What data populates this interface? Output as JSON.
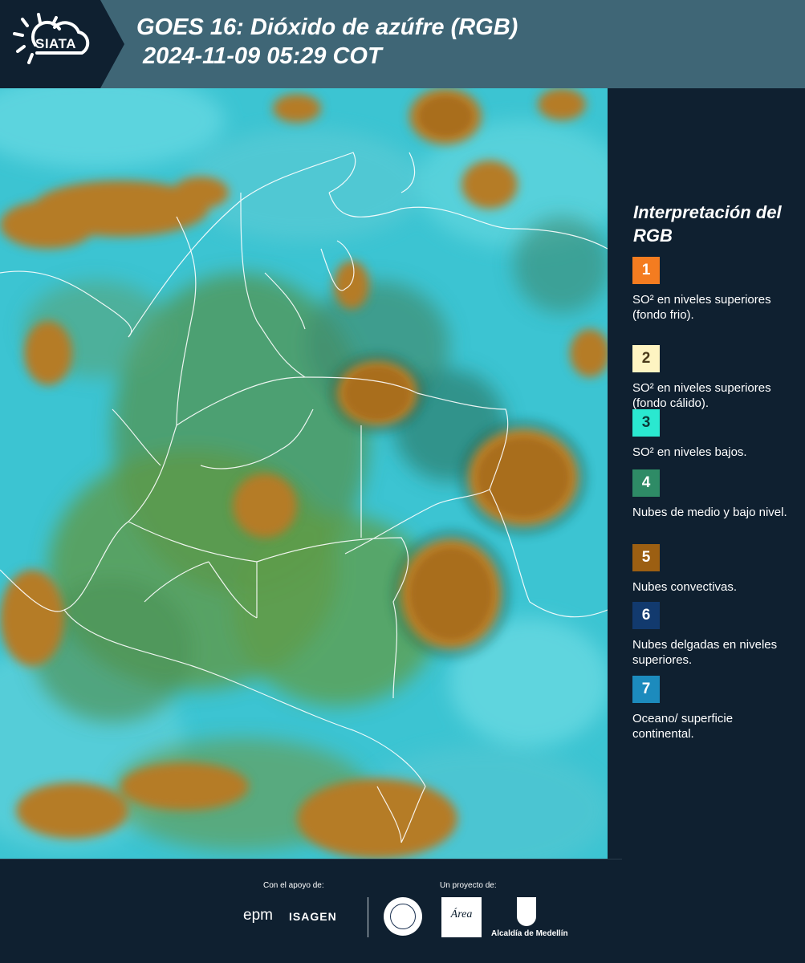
{
  "header": {
    "logo_text": "SIATA",
    "title_line1": "GOES 16: Dióxido de azúfre (RGB)",
    "title_line2": "2024-11-09 05:29 COT"
  },
  "legend": {
    "title": "Interpretación del RGB",
    "items": [
      {
        "number": "1",
        "color": "#f47c20",
        "text_color": "#ffffff",
        "label": "SO² en niveles superiores (fondo frio)."
      },
      {
        "number": "2",
        "color": "#fef4c2",
        "text_color": "#4a3a1a",
        "label": "SO² en niveles superiores (fondo cálido)."
      },
      {
        "number": "3",
        "color": "#2ae8d0",
        "text_color": "#0b3a38",
        "label": "SO² en niveles bajos."
      },
      {
        "number": "4",
        "color": "#2e8b66",
        "text_color": "#ffffff",
        "label": "Nubes de medio y bajo nivel."
      },
      {
        "number": "5",
        "color": "#9c5f12",
        "text_color": "#ffffff",
        "label": "Nubes convectivas."
      },
      {
        "number": "6",
        "color": "#123a6e",
        "text_color": "#ffffff",
        "label": "Nubes delgadas en niveles superiores."
      },
      {
        "number": "7",
        "color": "#1c8bbd",
        "text_color": "#ffffff",
        "label": "Oceano/ superficie continental."
      }
    ]
  },
  "footer": {
    "support_label": "Con el apoyo de:",
    "project_label": "Un proyecto de:",
    "epm_logo": "epm",
    "isagen_logo": "ISAGEN",
    "area_logo": "Área",
    "alcaldia_logo": "Alcaldía de Medellín"
  }
}
